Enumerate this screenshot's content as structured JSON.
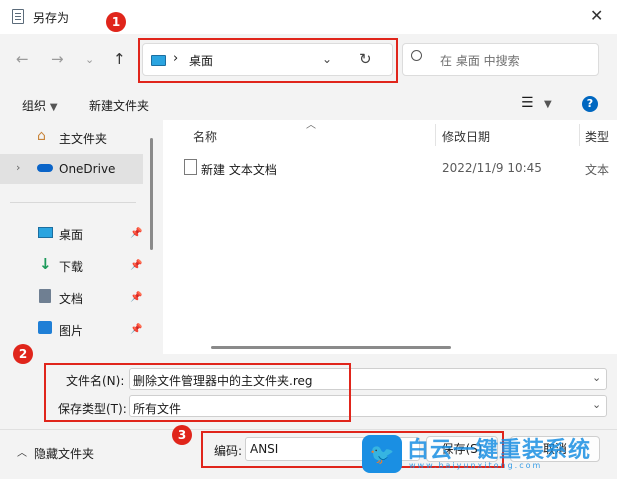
{
  "window": {
    "title": "另存为"
  },
  "address": {
    "folder": "桌面",
    "separator": "›"
  },
  "search": {
    "placeholder": "在 桌面 中搜索"
  },
  "toolbar": {
    "organize": "组织",
    "new_folder": "新建文件夹"
  },
  "sidebar": {
    "items": [
      {
        "label": "主文件夹"
      },
      {
        "label": "OneDrive"
      },
      {
        "label": "桌面"
      },
      {
        "label": "下载"
      },
      {
        "label": "文档"
      },
      {
        "label": "图片"
      }
    ]
  },
  "columns": {
    "name": "名称",
    "date": "修改日期",
    "type": "类型"
  },
  "files": [
    {
      "name": "新建 文本文档",
      "date": "2022/11/9 10:45",
      "type": "文本"
    }
  ],
  "form": {
    "filename_label": "文件名(N):",
    "filename_value": "删除文件管理器中的主文件夹.reg",
    "filetype_label": "保存类型(T):",
    "filetype_value": "所有文件",
    "encoding_label": "编码:",
    "encoding_value": "ANSI",
    "save": "保存(S)",
    "cancel": "取消",
    "hide_folders": "隐藏文件夹"
  },
  "badges": [
    "1",
    "2",
    "3"
  ],
  "watermark": {
    "text": "白云一键重装系统",
    "url": "www.baiyunxitong.com"
  },
  "colors": {
    "annotation_red": "#e0251b",
    "accent_blue": "#0067c0",
    "watermark_blue": "#1a8fe3"
  }
}
